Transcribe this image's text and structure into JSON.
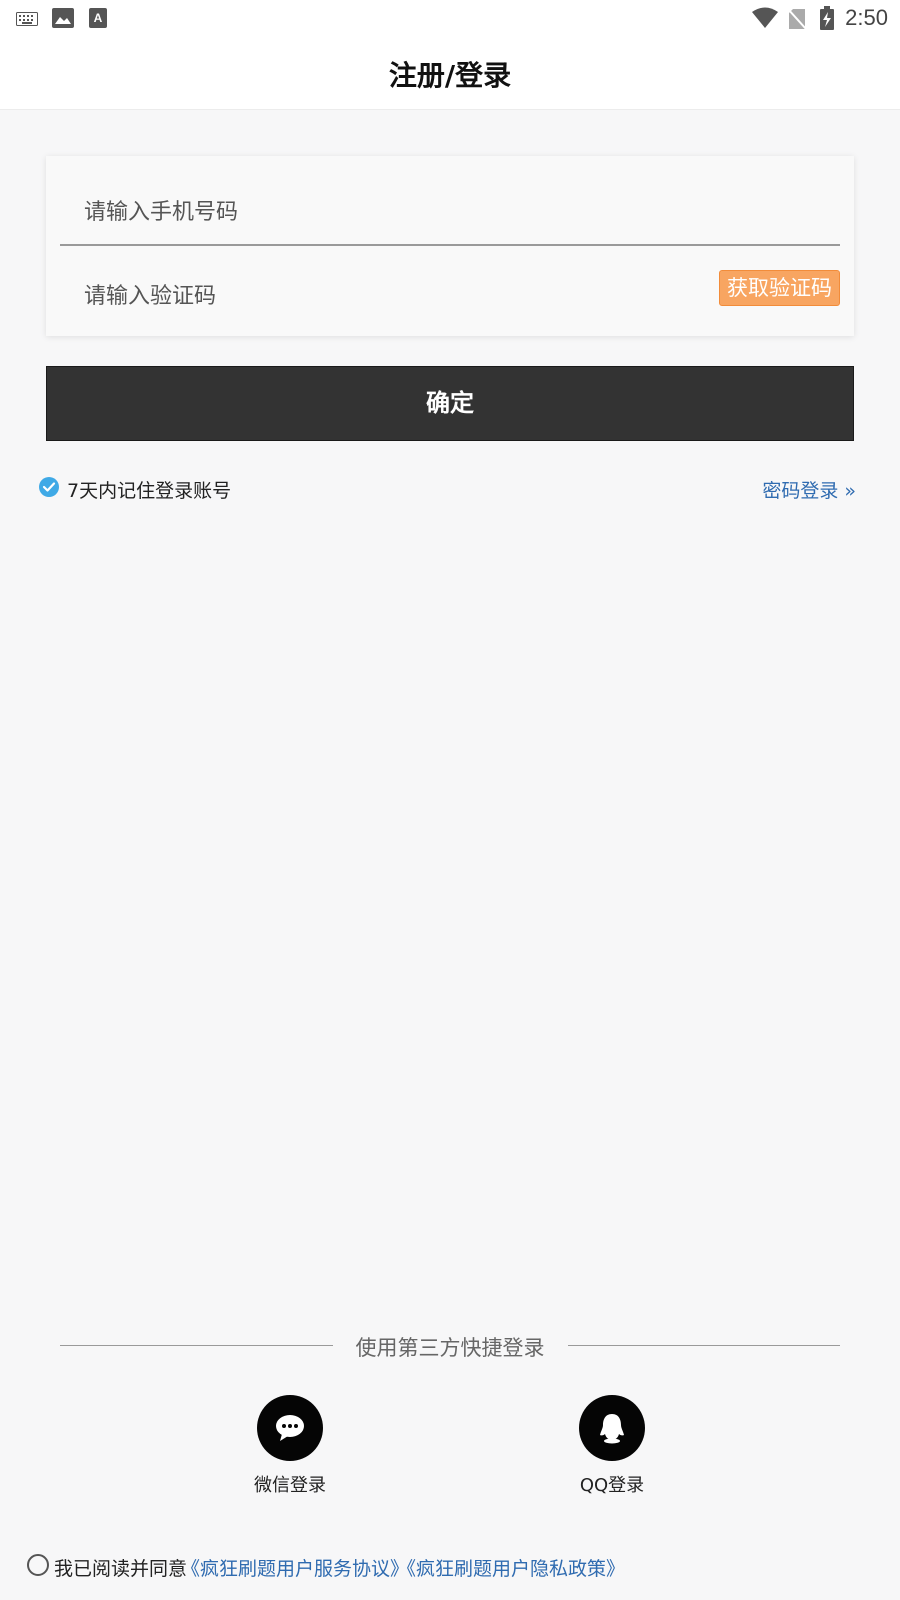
{
  "status_bar": {
    "time": "2:50",
    "left_icons": [
      "keyboard-icon",
      "image-icon",
      "text-a-icon"
    ],
    "right_icons": [
      "wifi-icon",
      "no-sim-icon",
      "battery-charging-icon"
    ]
  },
  "header": {
    "title": "注册/登录"
  },
  "form": {
    "phone_placeholder": "请输入手机号码",
    "code_placeholder": "请输入验证码",
    "get_code_label": "获取验证码",
    "confirm_label": "确定"
  },
  "options": {
    "remember_label": "7天内记住登录账号",
    "remember_checked": true,
    "password_login_label": "密码登录 »"
  },
  "third_party": {
    "divider_text": "使用第三方快捷登录",
    "providers": [
      {
        "label": "微信登录",
        "icon": "wechat-icon"
      },
      {
        "label": "QQ登录",
        "icon": "qq-icon"
      }
    ]
  },
  "agreement": {
    "prefix": "我已阅读并同意",
    "service_link": "《疯狂刷题用户服务协议》",
    "privacy_link": "《疯狂刷题用户隐私政策》",
    "checked": false
  },
  "colors": {
    "accent_orange": "#f8a561",
    "link_blue": "#2f6bb0",
    "check_blue": "#3fa9e6",
    "button_dark": "#333333"
  }
}
